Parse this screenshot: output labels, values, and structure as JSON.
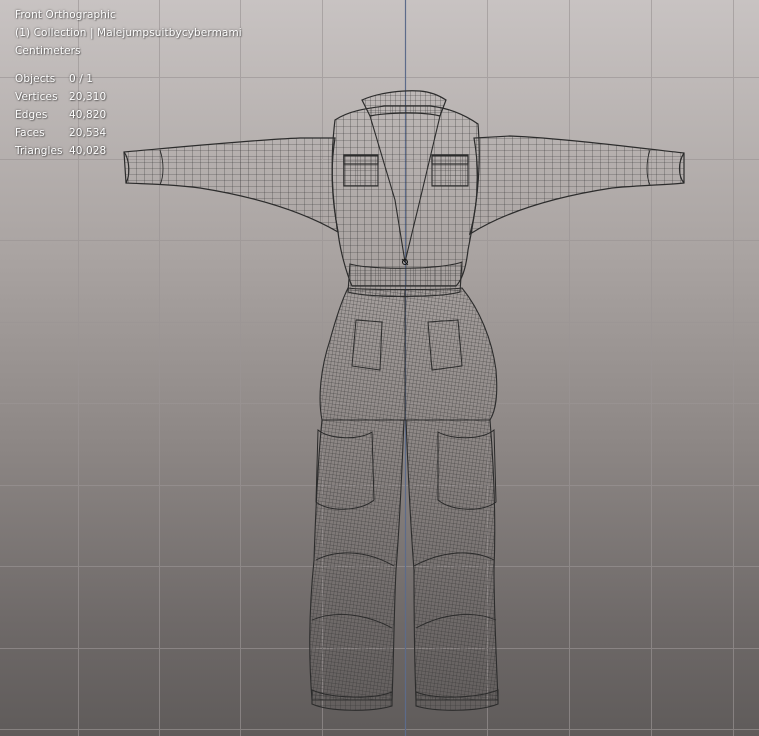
{
  "viewport": {
    "view_name": "Front Orthographic",
    "collection_line": "(1) Collection | Malejumpsuitbycybermami",
    "units": "Centimeters",
    "stats": [
      {
        "label": "Objects",
        "value": "0 / 1"
      },
      {
        "label": "Vertices",
        "value": "20,310"
      },
      {
        "label": "Edges",
        "value": "40,820"
      },
      {
        "label": "Faces",
        "value": "20,534"
      },
      {
        "label": "Triangles",
        "value": "40,028"
      }
    ]
  },
  "colors": {
    "grid_line": "#9c9696",
    "axis_line": "#5d6e8f",
    "wire": "#2e2e2e",
    "overlay_text": "#ffffff"
  }
}
